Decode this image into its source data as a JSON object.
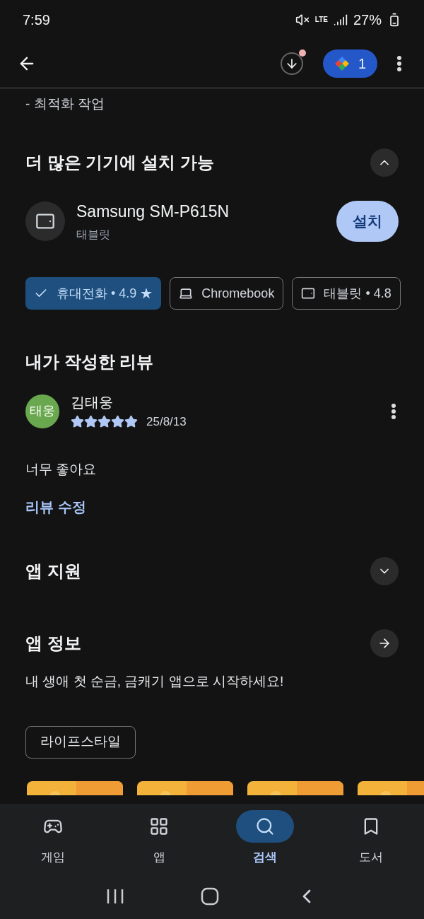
{
  "status_bar": {
    "time": "7:59",
    "battery": "27%",
    "network": "LTE"
  },
  "app_bar": {
    "badge_count": "1"
  },
  "top_text": "- 최적화 작업",
  "devices_section": {
    "title": "더 많은 기기에 설치 가능",
    "expanded": true,
    "device": {
      "name": "Samsung SM-P615N",
      "type": "태블릿",
      "button": "설치"
    },
    "chips": [
      {
        "kind": "phone",
        "label": "휴대전화 • 4.9 ★",
        "selected": true
      },
      {
        "kind": "laptop",
        "label": "Chromebook",
        "selected": false
      },
      {
        "kind": "tablet",
        "label": "태블릿 • 4.8",
        "selected": false
      }
    ]
  },
  "review_section": {
    "title": "내가 작성한 리뷰",
    "avatar": "태웅",
    "color": "#6aa84f",
    "author": "김태웅",
    "stars": 5,
    "date": "25/8/13",
    "text": "너무 좋아요",
    "edit_link": "리뷰 수정"
  },
  "support_section": {
    "title": "앱 지원",
    "expanded": false
  },
  "info_section": {
    "title": "앱 정보",
    "description": "내 생애 첫 순금, 금캐기 앱으로 시작하세요!",
    "tag": "라이프스타일"
  },
  "bottom_nav": [
    {
      "kind": "games",
      "label": "게임",
      "selected": false
    },
    {
      "kind": "apps",
      "label": "앱",
      "selected": false
    },
    {
      "kind": "search",
      "label": "검색",
      "selected": true
    },
    {
      "kind": "books",
      "label": "도서",
      "selected": false
    }
  ]
}
